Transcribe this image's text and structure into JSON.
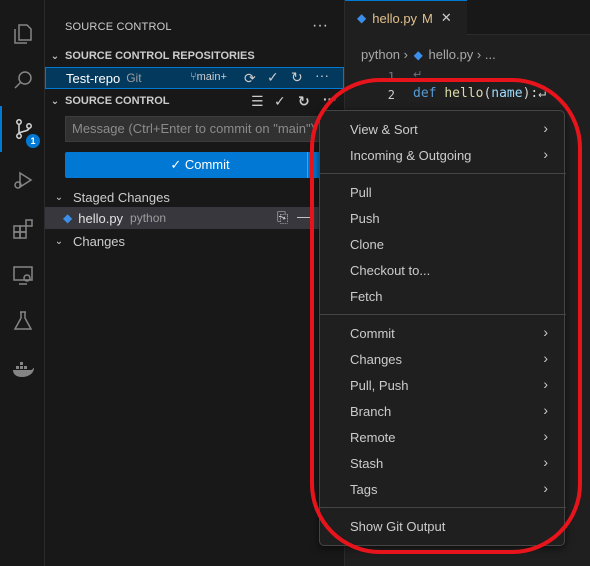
{
  "activity_bar": {
    "items": [
      "explorer-icon",
      "search-icon",
      "source-control-icon",
      "run-debug-icon",
      "extensions-icon",
      "remote-explorer-icon",
      "testing-icon",
      "docker-icon"
    ],
    "scm_badge": "1"
  },
  "sidebar": {
    "title": "SOURCE CONTROL",
    "more": "···",
    "repos_header": "SOURCE CONTROL REPOSITORIES",
    "repo": {
      "name": "Test-repo",
      "type": "Git",
      "branch": "main+"
    },
    "scm_header": "SOURCE CONTROL",
    "message_placeholder": "Message (Ctrl+Enter to commit on \"main\")",
    "commit_label": "✓ Commit",
    "staged_label": "Staged Changes",
    "staged_file": {
      "name": "hello.py",
      "lang": "python"
    },
    "changes_label": "Changes"
  },
  "editor": {
    "tab_name": "hello.py",
    "tab_status": "M",
    "breadcrumb": [
      "python",
      "hello.py",
      "..."
    ],
    "line_numbers": [
      "1",
      "2"
    ],
    "code_kw": "def",
    "code_fn": "hello",
    "code_open": "(",
    "code_param": "name",
    "code_close": "):↵",
    "line1_mark": "↵"
  },
  "menu": {
    "group1": [
      "View & Sort",
      "Incoming & Outgoing"
    ],
    "group2": [
      "Pull",
      "Push",
      "Clone",
      "Checkout to...",
      "Fetch"
    ],
    "group3": [
      "Commit",
      "Changes",
      "Pull, Push",
      "Branch",
      "Remote",
      "Stash",
      "Tags"
    ],
    "group4": [
      "Show Git Output"
    ]
  },
  "colors": {
    "accent": "#0078d4",
    "annotation": "#e8141c",
    "modified": "#e2c08d"
  }
}
